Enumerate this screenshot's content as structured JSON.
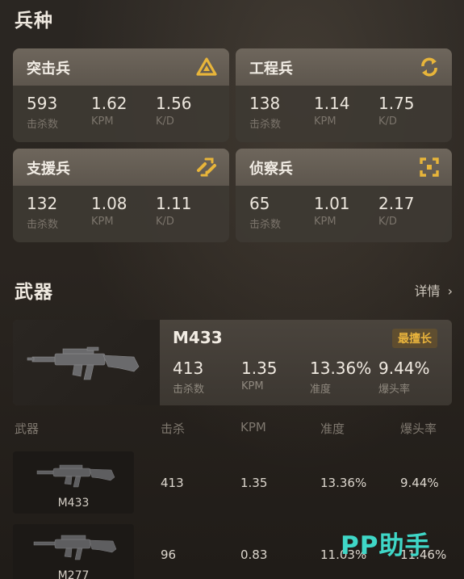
{
  "sections": {
    "classes_title": "兵种",
    "weapons_title": "武器",
    "details_link": "详情"
  },
  "classes": [
    {
      "name": "突击兵",
      "icon": "triangle-arrows-icon",
      "kills": "593",
      "kills_label": "击杀数",
      "kpm": "1.62",
      "kpm_label": "KPM",
      "kd": "1.56",
      "kd_label": "K/D"
    },
    {
      "name": "工程兵",
      "icon": "rotate-arrows-icon",
      "kills": "138",
      "kills_label": "击杀数",
      "kpm": "1.14",
      "kpm_label": "KPM",
      "kd": "1.75",
      "kd_label": "K/D"
    },
    {
      "name": "支援兵",
      "icon": "arrows-join-icon",
      "kills": "132",
      "kills_label": "击杀数",
      "kpm": "1.08",
      "kpm_label": "KPM",
      "kd": "1.11",
      "kd_label": "K/D"
    },
    {
      "name": "侦察兵",
      "icon": "target-frame-icon",
      "kills": "65",
      "kills_label": "击杀数",
      "kpm": "1.01",
      "kpm_label": "KPM",
      "kd": "2.17",
      "kd_label": "K/D"
    }
  ],
  "featured_weapon": {
    "name": "M433",
    "badge": "最擅长",
    "kills": "413",
    "kills_label": "击杀数",
    "kpm": "1.35",
    "kpm_label": "KPM",
    "accuracy": "13.36%",
    "accuracy_label": "准度",
    "headshot": "9.44%",
    "headshot_label": "爆头率"
  },
  "weapon_table": {
    "headers": [
      "武器",
      "击杀",
      "KPM",
      "准度",
      "爆头率"
    ],
    "rows": [
      {
        "name": "M433",
        "kills": "413",
        "kpm": "1.35",
        "accuracy": "13.36%",
        "headshot": "9.44%"
      },
      {
        "name": "M277",
        "kills": "96",
        "kpm": "0.83",
        "accuracy": "11.03%",
        "headshot": "11.46%"
      }
    ]
  },
  "watermark": "PP助手",
  "colors": {
    "accent_gold": "#e8b53a",
    "watermark": "#3fd7c7"
  }
}
